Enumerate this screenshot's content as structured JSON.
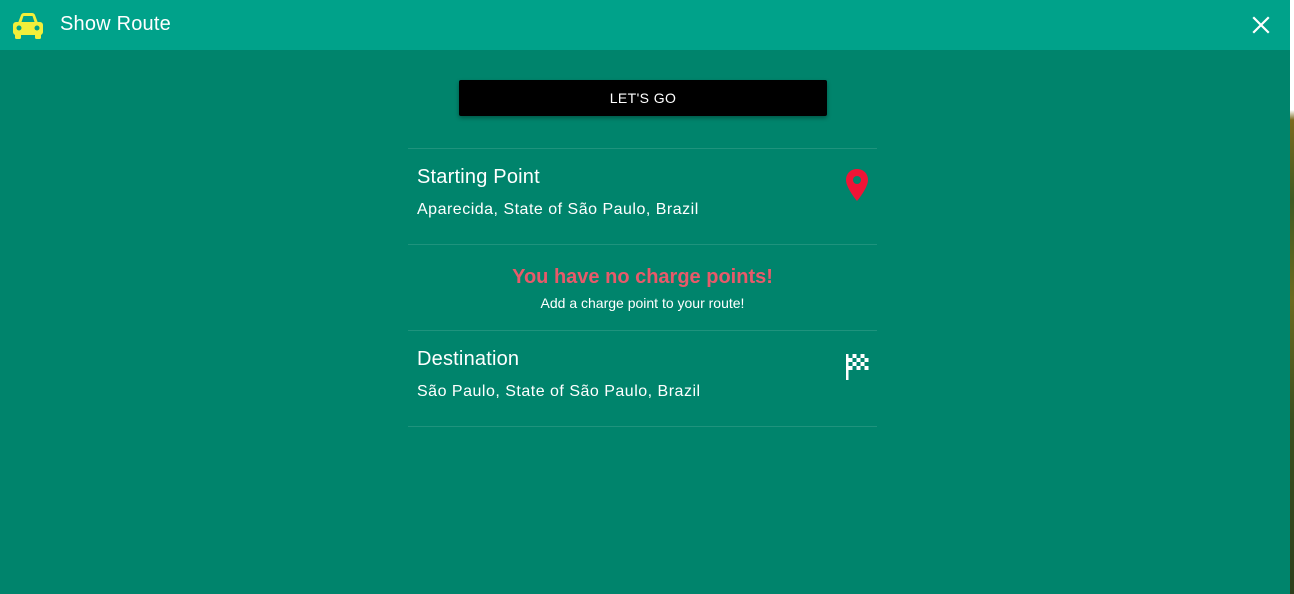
{
  "header": {
    "title": "Show Route",
    "icon": "car-icon",
    "close_icon": "close-icon"
  },
  "actions": {
    "go_label": "LET'S GO"
  },
  "route": {
    "start": {
      "title": "Starting Point",
      "address": "Aparecida, State of São Paulo, Brazil",
      "icon": "map-pin-icon"
    },
    "charge_points": {
      "empty_title": "You have no charge points!",
      "empty_subtitle": "Add a charge point to your route!"
    },
    "destination": {
      "title": "Destination",
      "address": "São Paulo, State of São Paulo, Brazil",
      "icon": "checkered-flag-icon"
    }
  },
  "colors": {
    "background": "#00846c",
    "header": "#00a28a",
    "car_icon": "#f2ef3a",
    "pin_icon": "#ef1436",
    "empty_warning": "#e85a6a",
    "button": "#000000"
  }
}
